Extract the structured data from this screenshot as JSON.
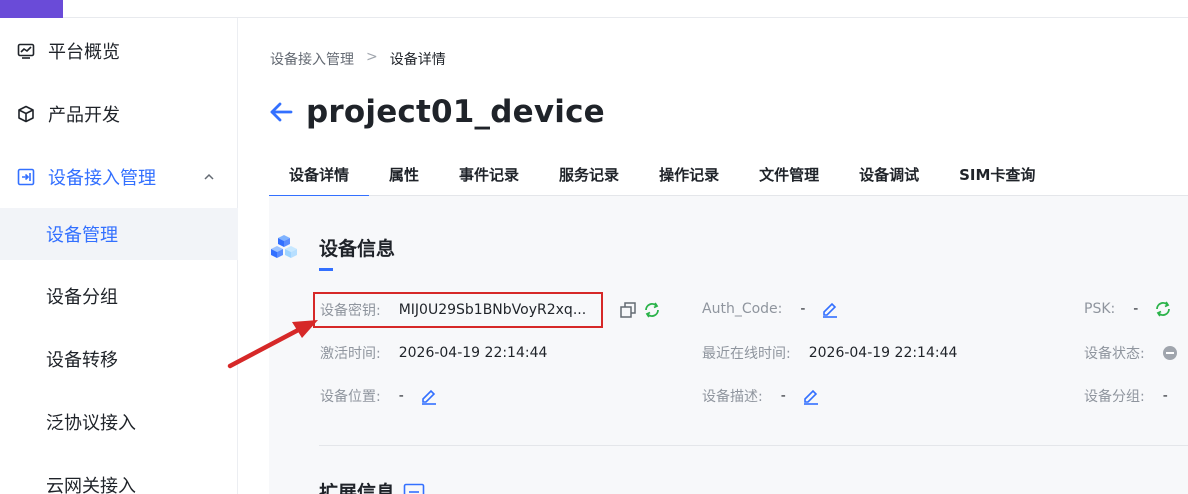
{
  "sidebar": {
    "items": [
      {
        "label": "平台概览",
        "icon": "chart-line-icon"
      },
      {
        "label": "产品开发",
        "icon": "cube-icon"
      },
      {
        "label": "设备接入管理",
        "icon": "device-access-icon",
        "expanded": true
      }
    ],
    "subitems": [
      {
        "label": "设备管理",
        "selected": true
      },
      {
        "label": "设备分组"
      },
      {
        "label": "设备转移"
      },
      {
        "label": "泛协议接入"
      },
      {
        "label": "云网关接入"
      }
    ]
  },
  "breadcrumb": {
    "parent": "设备接入管理",
    "separator": ">",
    "current": "设备详情"
  },
  "page": {
    "title": "project01_device"
  },
  "tabs": [
    "设备详情",
    "属性",
    "事件记录",
    "服务记录",
    "操作记录",
    "文件管理",
    "设备调试",
    "SIM卡查询"
  ],
  "active_tab": "设备详情",
  "device_info": {
    "section_title": "设备信息",
    "secret_label": "设备密钥:",
    "secret_value": "MIJ0U29Sb1BNbVoyR2xq...",
    "auth_label": "Auth_Code:",
    "auth_value": "-",
    "psk_label": "PSK:",
    "psk_value": "-",
    "activate_label": "激活时间:",
    "activate_value": "2026-04-19 22:14:44",
    "last_online_label": "最近在线时间:",
    "last_online_value": "2026-04-19 22:14:44",
    "status_label": "设备状态:",
    "location_label": "设备位置:",
    "location_value": "-",
    "desc_label": "设备描述:",
    "desc_value": "-",
    "group_label": "设备分组:",
    "group_value": "-"
  },
  "ext_info": {
    "section_title": "扩展信息"
  },
  "colors": {
    "accent": "#3370ff",
    "highlight": "#d62828",
    "refresh": "#2bb34a",
    "brand": "#6a4bd8"
  }
}
